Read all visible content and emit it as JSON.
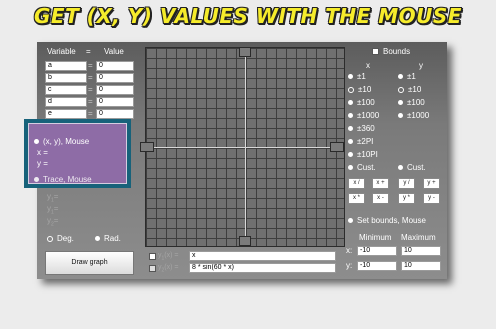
{
  "title": "GET (X, Y) VALUES WITH THE MOUSE",
  "table": {
    "header_variable": "Variable",
    "header_eq": "=",
    "header_value": "Value",
    "rows": [
      {
        "name": "a",
        "eq": "=",
        "value": "0"
      },
      {
        "name": "b",
        "eq": "=",
        "value": "0"
      },
      {
        "name": "c",
        "eq": "=",
        "value": "0"
      },
      {
        "name": "d",
        "eq": "=",
        "value": "0"
      },
      {
        "name": "e",
        "eq": "=",
        "value": "0"
      }
    ]
  },
  "overlay": {
    "mouse_label": "(x, y), Mouse",
    "x_label": "x =",
    "y_label": "y =",
    "partial_label": "Trace, Mouse"
  },
  "angle_mode": {
    "deg_label": "Deg.",
    "rad_label": "Rad.",
    "selected": "rad"
  },
  "draw_button_label": "Draw graph",
  "functions": [
    {
      "checked": true,
      "value": "x"
    },
    {
      "checked": false,
      "value": "8 * sin(60 * x)"
    }
  ],
  "bounds": {
    "label": "Bounds",
    "checked": true,
    "x_header": "x",
    "y_header": "y",
    "options_x": [
      {
        "label": "±1",
        "selected": true
      },
      {
        "label": "±10",
        "selected": false
      },
      {
        "label": "±100",
        "selected": true
      },
      {
        "label": "±1000",
        "selected": true
      },
      {
        "label": "±360",
        "selected": true
      },
      {
        "label": "±2PI",
        "selected": true
      },
      {
        "label": "±10PI",
        "selected": true
      },
      {
        "label": "Cust.",
        "selected": true
      }
    ],
    "options_y": [
      {
        "label": "±1",
        "selected": true
      },
      {
        "label": "±10",
        "selected": false
      },
      {
        "label": "±100",
        "selected": true
      },
      {
        "label": "±1000",
        "selected": true
      },
      {
        "label": "Cust.",
        "selected": true
      }
    ],
    "pan_buttons_row1": [
      "x /",
      "x +",
      "y /",
      "y +"
    ],
    "pan_buttons_row2": [
      "x *",
      "x -",
      "y *",
      "y -"
    ],
    "set_bounds_label": "Set bounds, Mouse",
    "min_header": "Minimum",
    "max_header": "Maximum",
    "x_row": {
      "label": "x:",
      "min": "-10",
      "max": "10"
    },
    "y_row": {
      "label": "y:",
      "min": "-10",
      "max": "10"
    }
  }
}
